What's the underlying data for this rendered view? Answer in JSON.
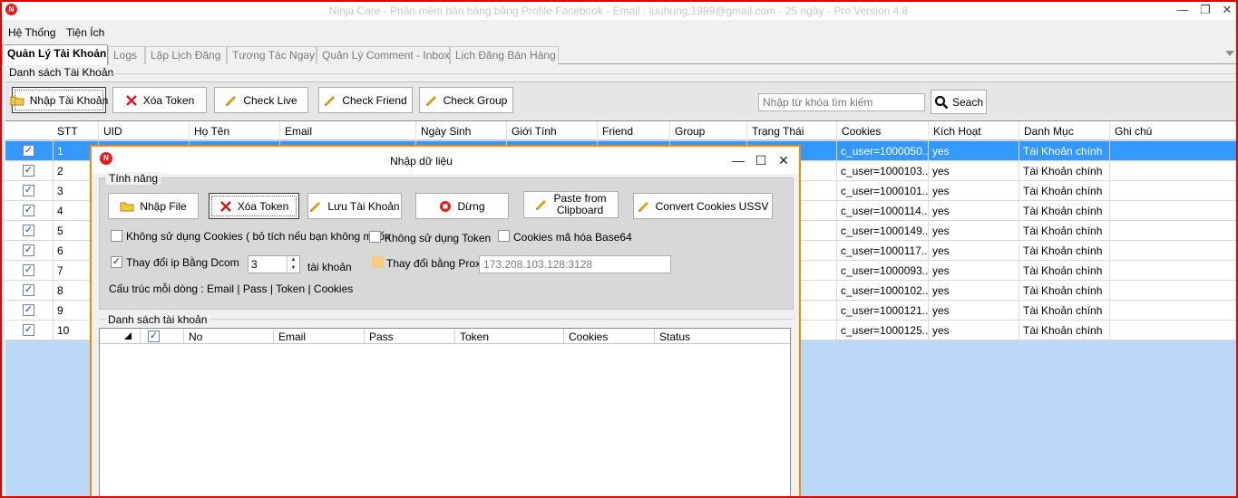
{
  "window": {
    "title": "Ninja Care - Phần mềm bán hàng bằng Profile Facebook - Email : luuhung.1989@gmail.com - 25 ngày - Pro Version 4.8",
    "icon": "app-logo-icon"
  },
  "menu": [
    "Hệ Thống",
    "Tiện Ích"
  ],
  "tabs": [
    "Quản Lý Tài Khoản",
    "Logs",
    "Lập Lịch Đăng",
    "Tương Tác Ngay",
    "Quản Lý Comment - Inbox",
    "Lịch Đăng Bán Hàng"
  ],
  "account_group_label": "Danh sách Tài Khoản",
  "toolbar": {
    "import_label": "Nhập Tài Khoản",
    "delete_token_label": "Xóa Token",
    "check_live_label": "Check Live",
    "check_friend_label": "Check Friend",
    "check_group_label": "Check Group",
    "search_placeholder": "Nhập từ khóa tìm kiếm",
    "search_label": "Seach"
  },
  "grid": {
    "columns": [
      "STT",
      "UID",
      "Họ Tên",
      "Email",
      "Ngày Sinh",
      "Giới Tính",
      "Friend",
      "Group",
      "Trạng Thái",
      "Cookies",
      "Kích Hoạt",
      "Danh Mục",
      "Ghi chú"
    ],
    "rows": [
      {
        "stt": "1",
        "cookies": "c_user=1000050...",
        "active": "yes",
        "category": "Tài Khoản chính"
      },
      {
        "stt": "2",
        "cookies": "c_user=1000103...",
        "active": "yes",
        "category": "Tài Khoản chính"
      },
      {
        "stt": "3",
        "cookies": "c_user=1000101...",
        "active": "yes",
        "category": "Tài Khoản chính"
      },
      {
        "stt": "4",
        "cookies": "c_user=1000114...",
        "active": "yes",
        "category": "Tài Khoản chính"
      },
      {
        "stt": "5",
        "cookies": "c_user=1000149...",
        "active": "yes",
        "category": "Tài Khoản chính"
      },
      {
        "stt": "6",
        "cookies": "c_user=1000117...",
        "active": "yes",
        "category": "Tài Khoản chính"
      },
      {
        "stt": "7",
        "cookies": "c_user=1000093...",
        "active": "yes",
        "category": "Tài Khoản chính"
      },
      {
        "stt": "8",
        "cookies": "c_user=1000102...",
        "active": "yes",
        "category": "Tài Khoản chính"
      },
      {
        "stt": "9",
        "cookies": "c_user=1000121...",
        "active": "yes",
        "category": "Tài Khoản chính"
      },
      {
        "stt": "10",
        "cookies": "c_user=1000125...",
        "active": "yes",
        "category": "Tài Khoản chính"
      }
    ]
  },
  "dialog": {
    "title": "Nhập dữ liệu",
    "features_label": "Tính năng",
    "buttons": {
      "import_file": "Nhập File",
      "delete_token": "Xóa Token",
      "save_account": "Lưu Tài Khoản",
      "stop": "Dừng",
      "paste_line1": "Paste from",
      "paste_line2": "Clipboard",
      "convert_cookies": "Convert Cookies USSV"
    },
    "options": {
      "no_cookies": "Không sử dụng Cookies ( bỏ tích nếu bạn không muốn",
      "no_token": "Không sử dụng Token",
      "cookies_base64": "Cookies mã hóa Base64",
      "change_ip_dcom": "Thay đổi ip Bằng Dcom",
      "dcom_value": "3",
      "account_unit": "tài khoản",
      "change_proxy": "Thay đổi bằng Proxy",
      "proxy_value": "173.208.103.128:3128",
      "line_format": "Cấu trúc mỗi dòng : Email | Pass | Token | Cookies"
    },
    "list_label": "Danh sách tài khoản",
    "list_columns": [
      "No",
      "Email",
      "Pass",
      "Token",
      "Cookies",
      "Status"
    ]
  }
}
